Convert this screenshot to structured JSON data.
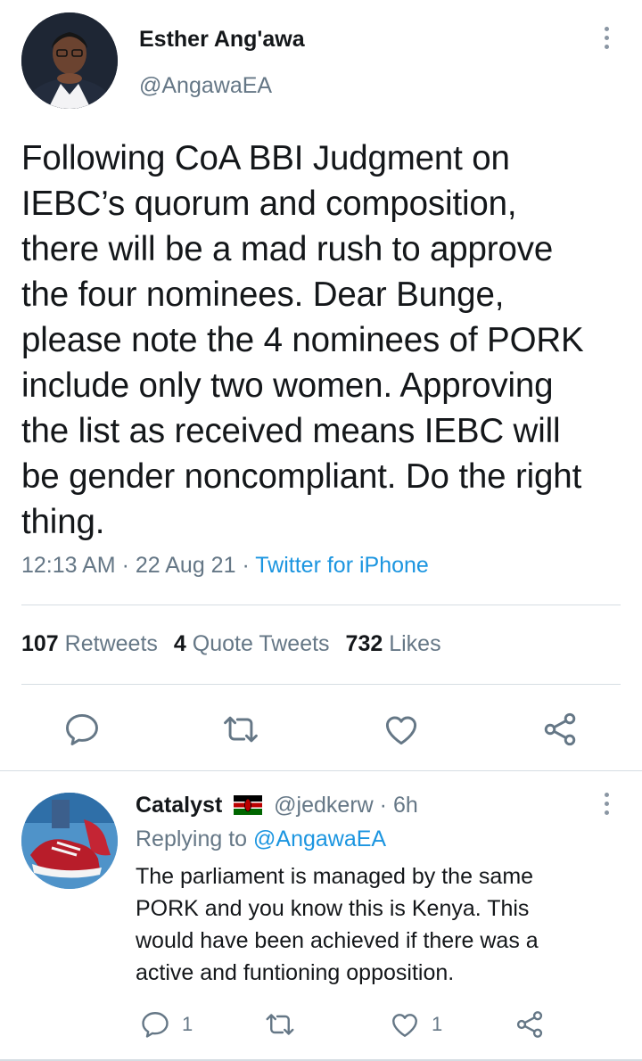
{
  "main_tweet": {
    "author_name": "Esther Ang'awa",
    "author_handle": "@AngawaEA",
    "text_lines": [
      "Following CoA BBI Judgment on",
      "IEBC’s quorum and composition,",
      "there will be a mad rush to approve",
      "the four nominees. Dear Bunge,",
      "please note the 4 nominees of PORK",
      "include only two women. Approving",
      "the list as received means IEBC will",
      "be gender noncompliant. Do the right",
      "thing."
    ],
    "time": "12:13 AM",
    "date": "22 Aug 21",
    "source": "Twitter for iPhone",
    "stats": {
      "retweets_count": "107",
      "retweets_label": "Retweets",
      "quotes_count": "4",
      "quotes_label": "Quote Tweets",
      "likes_count": "732",
      "likes_label": "Likes"
    },
    "actions": [
      "reply-icon",
      "retweet-icon",
      "like-icon",
      "share-icon"
    ]
  },
  "reply": {
    "author_name": "Catalyst",
    "flag": "kenya-flag",
    "author_handle": "@jedkerw",
    "time": "6h",
    "replying_prefix": "Replying to",
    "replying_to": "@AngawaEA",
    "text_lines": [
      "The parliament is managed by the same",
      "PORK and you know this is Kenya. This",
      "would have been achieved if there was a",
      "active and funtioning opposition."
    ],
    "reply_count": "1",
    "like_count": "1"
  },
  "colors": {
    "text": "#14171a",
    "secondary": "#657786",
    "link": "#1b95e0",
    "icon": "#657786",
    "divider": "#d6dde3"
  }
}
